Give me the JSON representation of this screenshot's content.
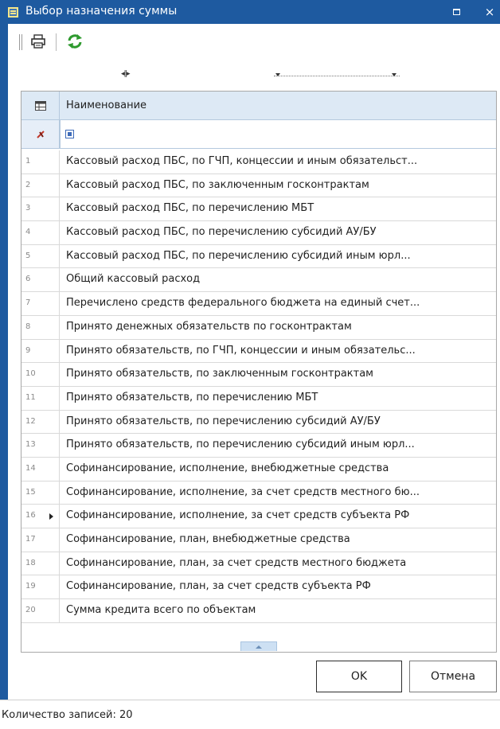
{
  "window": {
    "title": "Выбор назначения суммы",
    "maximize_glyph": "□",
    "close_glyph": "×"
  },
  "toolbar": {
    "icons": [
      "grip-icon",
      "printer-icon",
      "refresh-icon"
    ]
  },
  "grid": {
    "column_header": "Наименование",
    "current_row": 16,
    "rows": [
      {
        "num": "1",
        "text": "Кассовый расход ПБС, по ГЧП, концессии и иным обязательст..."
      },
      {
        "num": "2",
        "text": "Кассовый расход ПБС, по заключенным госконтрактам"
      },
      {
        "num": "3",
        "text": "Кассовый расход ПБС, по перечислению МБТ"
      },
      {
        "num": "4",
        "text": "Кассовый расход ПБС, по перечислению субсидий АУ/БУ"
      },
      {
        "num": "5",
        "text": "Кассовый расход ПБС, по перечислению субсидий иным юрл..."
      },
      {
        "num": "6",
        "text": "Общий кассовый расход"
      },
      {
        "num": "7",
        "text": "Перечислено средств федерального бюджета на единый счет..."
      },
      {
        "num": "8",
        "text": "Принято денежных обязательств по госконтрактам"
      },
      {
        "num": "9",
        "text": "Принято обязательств, по ГЧП, концессии и иным обязательс..."
      },
      {
        "num": "10",
        "text": "Принято обязательств, по заключенным госконтрактам"
      },
      {
        "num": "11",
        "text": "Принято обязательств, по перечислению МБТ"
      },
      {
        "num": "12",
        "text": "Принято обязательств, по перечислению субсидий АУ/БУ"
      },
      {
        "num": "13",
        "text": "Принято обязательств, по перечислению субсидий иным юрл..."
      },
      {
        "num": "14",
        "text": "Софинансирование, исполнение, внебюджетные средства"
      },
      {
        "num": "15",
        "text": "Софинансирование, исполнение, за счет средств местного бю..."
      },
      {
        "num": "16",
        "text": "Софинансирование, исполнение, за счет средств субъекта РФ"
      },
      {
        "num": "17",
        "text": "Софинансирование, план, внебюджетные средства"
      },
      {
        "num": "18",
        "text": "Софинансирование, план, за счет средств местного бюджета"
      },
      {
        "num": "19",
        "text": "Софинансирование, план, за счет средств субъекта РФ"
      },
      {
        "num": "20",
        "text": "Сумма кредита всего по объектам"
      }
    ]
  },
  "buttons": {
    "ok": "OK",
    "cancel": "Отмена"
  },
  "status": {
    "records": "Количество записей: 20"
  },
  "colors": {
    "title_bar": "#1e5aa0",
    "grid_header": "#dde9f5",
    "refresh_green": "#2e9a2e"
  }
}
